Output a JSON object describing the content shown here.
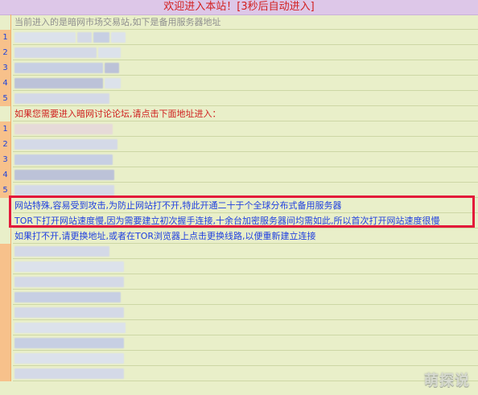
{
  "header": {
    "title": "欢迎进入本站！[3秒后自动进入]"
  },
  "main": {
    "notice_1": "当前进入的是暗网市场交易站,如下是备用服务器地址",
    "notice_2": "如果您需要进入暗网讨论论坛,请点击下面地址进入：",
    "notice_3": "网站特殊,容易受到攻击,为防止网站打不开,特此开通二十于个全球分布式备用服务器",
    "notice_4": "TOR下打开网站速度慢,因为需要建立初次握手连接,十余台加密服务器间均需如此,所以首次打开网站速度很慢",
    "notice_5": "如果打不开,请更换地址,或者在TOR浏览器上点击更换线路,以便重新建立连接"
  },
  "list_numbers": [
    "1",
    "2",
    "3",
    "4",
    "5"
  ],
  "watermark": "萌探说",
  "colors": {
    "header_bg": "#ddc7e8",
    "body_bg": "#e9efc9",
    "number_bg": "#f7c18b",
    "highlight_border": "#e3193a",
    "title_red": "#d21f1f",
    "link_blue": "#1f3fe0"
  }
}
